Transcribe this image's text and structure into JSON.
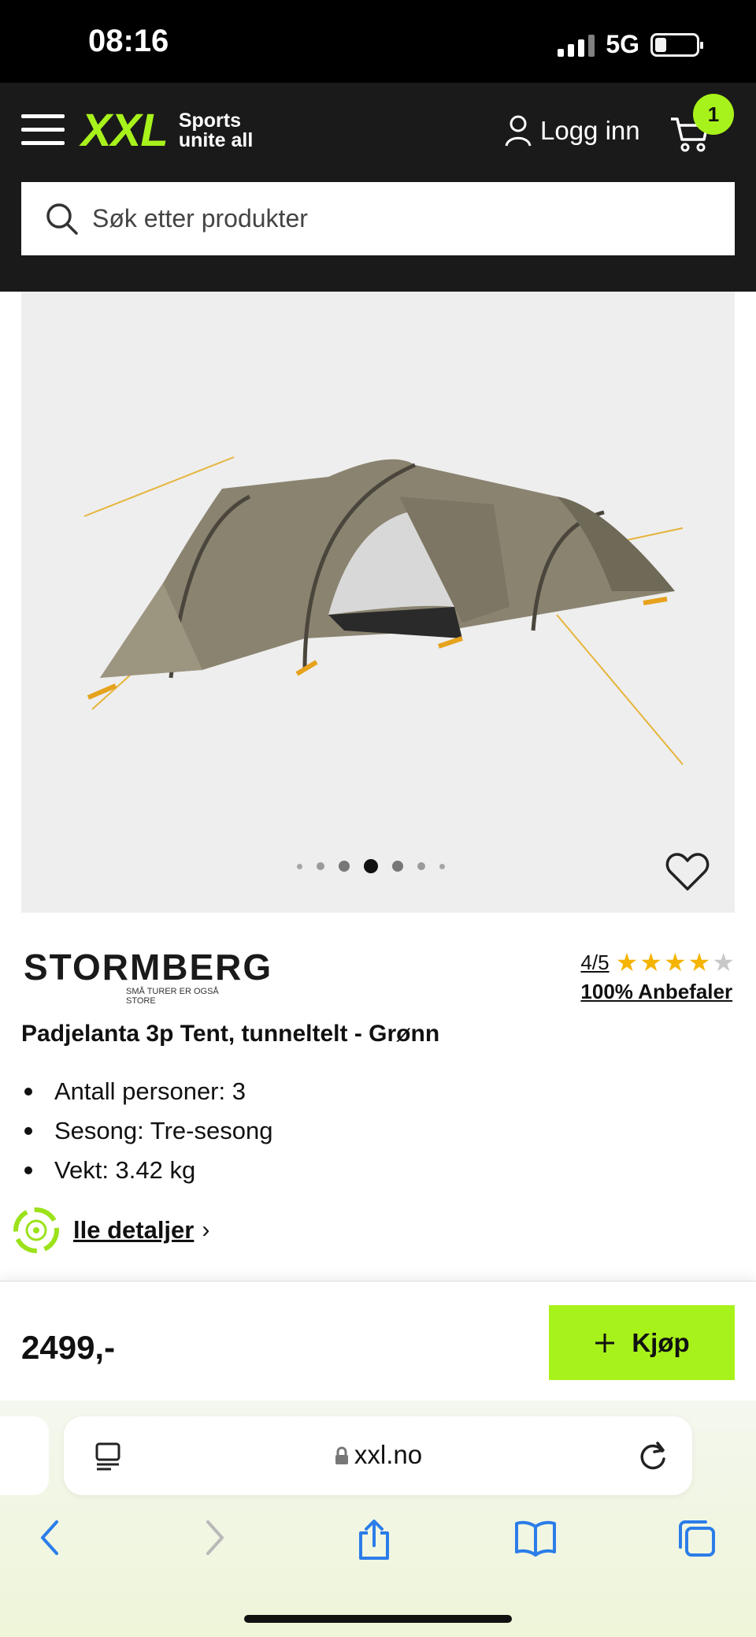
{
  "status_bar": {
    "time": "08:16",
    "network": "5G"
  },
  "header": {
    "logo_text": "XXL",
    "logo_tagline_1": "Sports",
    "logo_tagline_2": "unite all",
    "login_label": "Logg inn",
    "cart_count": "1",
    "search_placeholder": "Søk etter produkter"
  },
  "gallery": {
    "image_count": 7,
    "active_index": 3
  },
  "product": {
    "brand": "STORMBERG",
    "brand_tagline": "SMÅ TURER ER OGSÅ STORE",
    "rating": "4/5",
    "rating_value": 4,
    "rating_max": 5,
    "recommend": "100% Anbefaler",
    "title": "Padjelanta 3p Tent, tunneltelt - Grønn",
    "specs": [
      "Antall personer: 3",
      "Sesong: Tre-sesong",
      "Vekt: 3.42 kg"
    ],
    "details_link": "lle detaljer"
  },
  "buy_bar": {
    "price": "2499,-",
    "buy_label": "Kjøp"
  },
  "browser": {
    "url": "xxl.no"
  },
  "colors": {
    "accent": "#a8f21b",
    "header_bg": "#1a1a1a",
    "star": "#f5b400",
    "star_empty": "#c8c8c8"
  }
}
